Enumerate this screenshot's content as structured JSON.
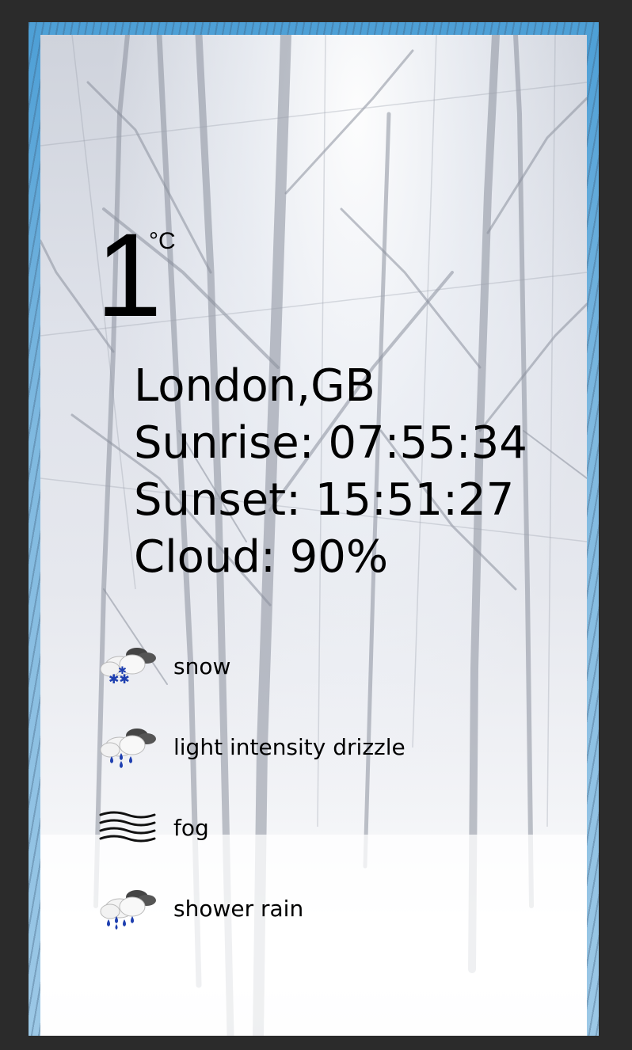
{
  "weather": {
    "temperature": "1",
    "unit": "°C",
    "location": "London,GB",
    "sunrise": "Sunrise: 07:55:34",
    "sunset": "Sunset: 15:51:27",
    "cloud": "Cloud: 90%"
  },
  "forecast": [
    {
      "label": "snow",
      "icon": "snow-cloud-icon"
    },
    {
      "label": "light intensity drizzle",
      "icon": "drizzle-cloud-icon"
    },
    {
      "label": "fog",
      "icon": "fog-icon"
    },
    {
      "label": "shower rain",
      "icon": "shower-rain-cloud-icon"
    }
  ],
  "colors": {
    "page_background": "#2b2b2b",
    "frame_accent": "#4d9fd6",
    "icon_drop": "#1e3fb0",
    "text": "#000000"
  }
}
